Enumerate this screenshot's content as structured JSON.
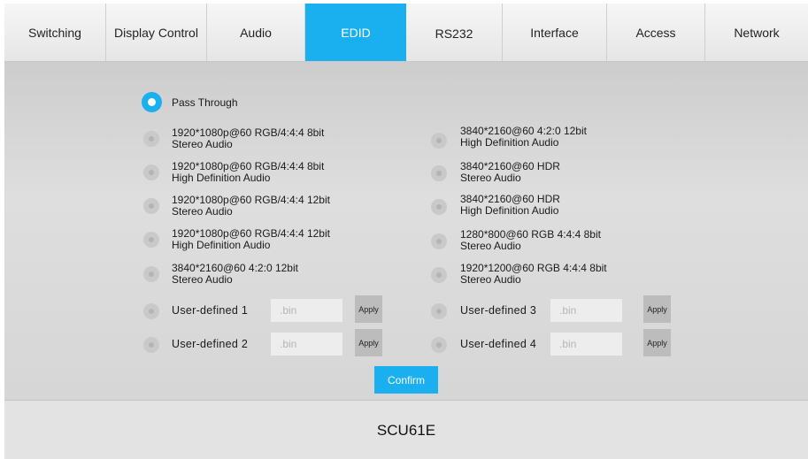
{
  "tabs": [
    {
      "label": "Switching"
    },
    {
      "label": "Display Control"
    },
    {
      "label": "Audio"
    },
    {
      "label": "EDID"
    },
    {
      "label": "RS232"
    },
    {
      "label": "Interface"
    },
    {
      "label": "Access"
    },
    {
      "label": "Network"
    }
  ],
  "active_tab": "EDID",
  "accent_color": "#1ab0f0",
  "edid": {
    "selected": "Pass Through",
    "pass_through_label": "Pass Through",
    "left_options": [
      {
        "line1": "1920*1080p@60 RGB/4:4:4 8bit",
        "line2": "Stereo Audio"
      },
      {
        "line1": "1920*1080p@60 RGB/4:4:4 8bit",
        "line2": "High Definition Audio"
      },
      {
        "line1": "1920*1080p@60 RGB/4:4:4 12bit",
        "line2": "Stereo Audio"
      },
      {
        "line1": "1920*1080p@60 RGB/4:4:4 12bit",
        "line2": "High Definition Audio"
      },
      {
        "line1": "3840*2160@60 4:2:0 12bit",
        "line2": "Stereo Audio"
      }
    ],
    "right_options": [
      {
        "line1": "3840*2160@60 4:2:0 12bit",
        "line2": "High Definition Audio"
      },
      {
        "line1": "3840*2160@60 HDR",
        "line2": "Stereo Audio"
      },
      {
        "line1": "3840*2160@60 HDR",
        "line2": "High Definition Audio"
      },
      {
        "line1": "1280*800@60 RGB 4:4:4 8bit",
        "line2": "Stereo Audio"
      },
      {
        "line1": "1920*1200@60 RGB 4:4:4 8bit",
        "line2": "Stereo Audio"
      }
    ],
    "user_defined": [
      {
        "label": "User-defined 1",
        "placeholder": ".bin",
        "apply": "Apply"
      },
      {
        "label": "User-defined 2",
        "placeholder": ".bin",
        "apply": "Apply"
      },
      {
        "label": "User-defined 3",
        "placeholder": ".bin",
        "apply": "Apply"
      },
      {
        "label": "User-defined 4",
        "placeholder": ".bin",
        "apply": "Apply"
      }
    ],
    "confirm_label": "Confirm"
  },
  "footer": {
    "model": "SCU61E"
  }
}
